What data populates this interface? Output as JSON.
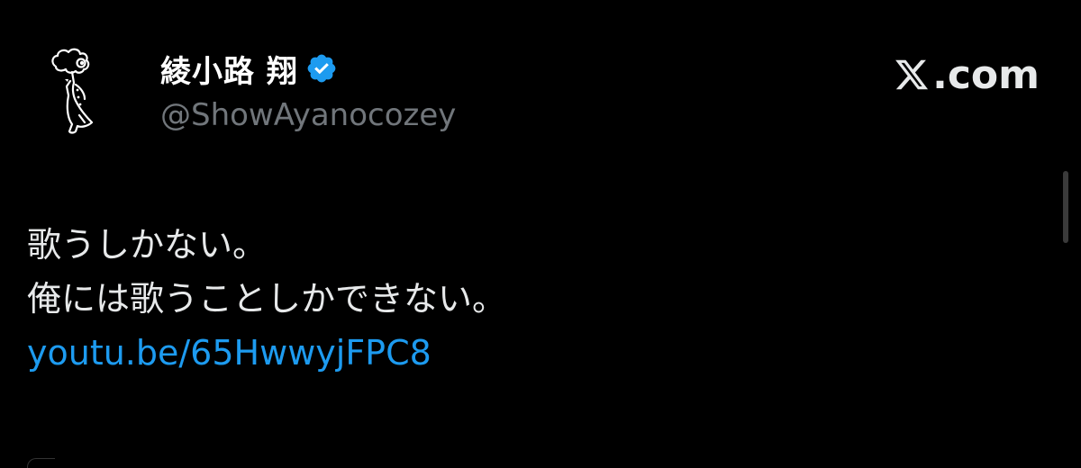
{
  "profile": {
    "display_name": "綾小路 翔",
    "handle": "@ShowAyanocozey",
    "verified": true,
    "avatar_icon": "cartoon-character-avatar-icon",
    "verified_icon": "verified-badge-icon"
  },
  "brand": {
    "label": ".com",
    "icon": "x-logo-icon"
  },
  "tweet": {
    "lines": [
      "歌うしかない。",
      "俺には歌うことしかできない。"
    ],
    "link": "youtu.be/65HwwyjFPC8"
  },
  "colors": {
    "background": "#000000",
    "text": "#e7e9ea",
    "secondary_text": "#71767b",
    "link": "#1d9bf0",
    "verified_badge": "#1d9bf0"
  }
}
